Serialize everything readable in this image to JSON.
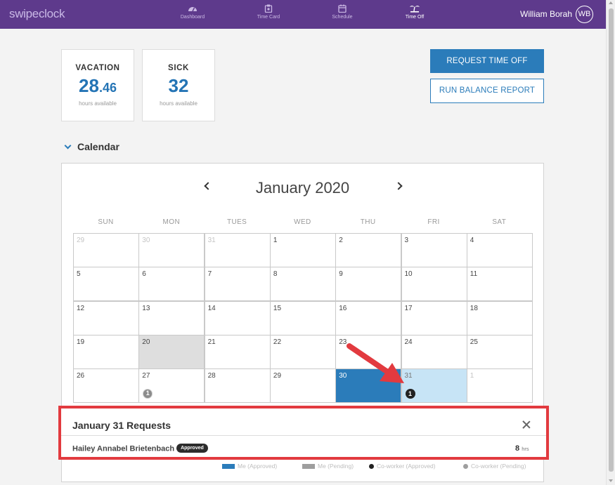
{
  "app": {
    "logo": "swipeclock"
  },
  "nav": {
    "items": [
      {
        "label": "Dashboard",
        "icon": "gauge-icon",
        "active": false
      },
      {
        "label": "Time Card",
        "icon": "timecard-icon",
        "active": false
      },
      {
        "label": "Schedule",
        "icon": "calendar-icon",
        "active": false
      },
      {
        "label": "Time Off",
        "icon": "palm-tree-icon",
        "active": true
      }
    ],
    "user_name": "William Borah",
    "user_initials": "WB"
  },
  "balances": [
    {
      "title": "VACATION",
      "value_int": "28",
      "value_dec": ".46",
      "sub": "hours available"
    },
    {
      "title": "SICK",
      "value_int": "32",
      "value_dec": "",
      "sub": "hours available"
    }
  ],
  "actions": {
    "request_label": "REQUEST TIME OFF",
    "report_label": "RUN BALANCE REPORT"
  },
  "calendar": {
    "section_title": "Calendar",
    "month_label": "January 2020",
    "weekdays": [
      "SUN",
      "MON",
      "TUES",
      "WED",
      "THU",
      "FRI",
      "SAT"
    ],
    "weeks": [
      [
        {
          "d": "29",
          "style": "other"
        },
        {
          "d": "30",
          "style": "other"
        },
        {
          "d": "31",
          "style": "other"
        },
        {
          "d": "1"
        },
        {
          "d": "2"
        },
        {
          "d": "3"
        },
        {
          "d": "4"
        }
      ],
      [
        {
          "d": "5"
        },
        {
          "d": "6"
        },
        {
          "d": "7"
        },
        {
          "d": "8"
        },
        {
          "d": "9"
        },
        {
          "d": "10"
        },
        {
          "d": "11"
        }
      ],
      [
        {
          "d": "12"
        },
        {
          "d": "13"
        },
        {
          "d": "14"
        },
        {
          "d": "15"
        },
        {
          "d": "16"
        },
        {
          "d": "17"
        },
        {
          "d": "18"
        }
      ],
      [
        {
          "d": "19"
        },
        {
          "d": "20",
          "style": "gray"
        },
        {
          "d": "21"
        },
        {
          "d": "22"
        },
        {
          "d": "23"
        },
        {
          "d": "24"
        },
        {
          "d": "25"
        }
      ],
      [
        {
          "d": "26"
        },
        {
          "d": "27",
          "badge": "1",
          "badge_style": "gray"
        },
        {
          "d": "28"
        },
        {
          "d": "29"
        },
        {
          "d": "30",
          "style": "sel"
        },
        {
          "d": "31",
          "style": "light",
          "badge": "1",
          "badge_style": "dark"
        },
        {
          "d": "1",
          "style": "other"
        }
      ]
    ],
    "legend": [
      {
        "label": "Me (Approved)",
        "kind": "swatch",
        "color": "#2b7cba"
      },
      {
        "label": "Me (Pending)",
        "kind": "swatch",
        "color": "#9e9e9e"
      },
      {
        "label": "Co-worker (Approved)",
        "kind": "dot",
        "color": "#222222"
      },
      {
        "label": "Co-worker (Pending)",
        "kind": "dot",
        "color": "#9e9e9e"
      }
    ]
  },
  "requests": {
    "title": "January 31 Requests",
    "items": [
      {
        "name": "Hailey Annabel Brietenbach",
        "status": "Approved",
        "hours": "8",
        "unit": "hrs"
      }
    ]
  },
  "colors": {
    "brand": "#5e3a8c",
    "accent": "#2b7cba",
    "highlight": "#e23a3f"
  }
}
